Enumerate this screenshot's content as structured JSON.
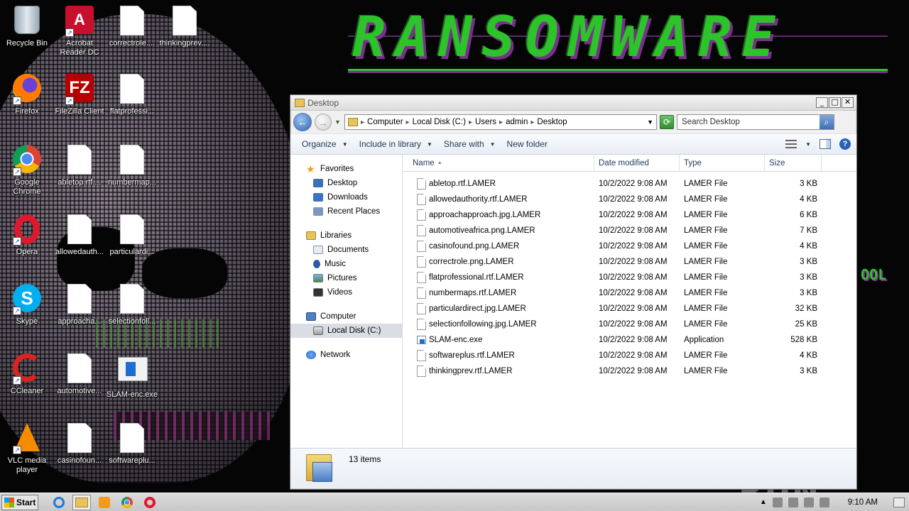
{
  "desktop": {
    "wallpaper_title": "RANSOMWARE",
    "wallpaper_side_text": "OOL",
    "icons": [
      {
        "label": "Recycle Bin"
      },
      {
        "label": "Acrobat Reader DC"
      },
      {
        "label": "correctrole...."
      },
      {
        "label": "thinkingprev...."
      },
      {
        "label": "Firefox"
      },
      {
        "label": "FileZilla Client"
      },
      {
        "label": "flatprofessi..."
      },
      {
        "label": "Google Chrome"
      },
      {
        "label": "abletop.rtf...."
      },
      {
        "label": "numbermap..."
      },
      {
        "label": "Opera"
      },
      {
        "label": "allowedauth..."
      },
      {
        "label": "particulardi..."
      },
      {
        "label": "Skype"
      },
      {
        "label": "approacha..."
      },
      {
        "label": "selectionfoll..."
      },
      {
        "label": "CCleaner"
      },
      {
        "label": "automotive..."
      },
      {
        "label": "SLAM-enc.exe"
      },
      {
        "label": "VLC media player"
      },
      {
        "label": "casinofoun..."
      },
      {
        "label": "softwareplu..."
      }
    ]
  },
  "window": {
    "title": "Desktop",
    "buttons": {
      "minimize": "_",
      "maximize": "□",
      "close": "✕"
    },
    "address": {
      "crumbs": [
        "Computer",
        "Local Disk (C:)",
        "Users",
        "admin",
        "Desktop"
      ]
    },
    "search_placeholder": "Search Desktop",
    "toolbar": {
      "organize": "Organize",
      "include_in_library": "Include in library",
      "share_with": "Share with",
      "new_folder": "New folder"
    },
    "nav": {
      "favorites": "Favorites",
      "favorites_items": [
        "Desktop",
        "Downloads",
        "Recent Places"
      ],
      "libraries": "Libraries",
      "libraries_items": [
        "Documents",
        "Music",
        "Pictures",
        "Videos"
      ],
      "computer": "Computer",
      "computer_items": [
        "Local Disk (C:)"
      ],
      "network": "Network"
    },
    "columns": {
      "name": "Name",
      "date": "Date modified",
      "type": "Type",
      "size": "Size"
    },
    "files": [
      {
        "name": "abletop.rtf.LAMER",
        "date": "10/2/2022 9:08 AM",
        "type": "LAMER File",
        "size": "3 KB"
      },
      {
        "name": "allowedauthority.rtf.LAMER",
        "date": "10/2/2022 9:08 AM",
        "type": "LAMER File",
        "size": "4 KB"
      },
      {
        "name": "approachapproach.jpg.LAMER",
        "date": "10/2/2022 9:08 AM",
        "type": "LAMER File",
        "size": "6 KB"
      },
      {
        "name": "automotiveafrica.png.LAMER",
        "date": "10/2/2022 9:08 AM",
        "type": "LAMER File",
        "size": "7 KB"
      },
      {
        "name": "casinofound.png.LAMER",
        "date": "10/2/2022 9:08 AM",
        "type": "LAMER File",
        "size": "4 KB"
      },
      {
        "name": "correctrole.png.LAMER",
        "date": "10/2/2022 9:08 AM",
        "type": "LAMER File",
        "size": "3 KB"
      },
      {
        "name": "flatprofessional.rtf.LAMER",
        "date": "10/2/2022 9:08 AM",
        "type": "LAMER File",
        "size": "3 KB"
      },
      {
        "name": "numbermaps.rtf.LAMER",
        "date": "10/2/2022 9:08 AM",
        "type": "LAMER File",
        "size": "3 KB"
      },
      {
        "name": "particulardirect.jpg.LAMER",
        "date": "10/2/2022 9:08 AM",
        "type": "LAMER File",
        "size": "32 KB"
      },
      {
        "name": "selectionfollowing.jpg.LAMER",
        "date": "10/2/2022 9:08 AM",
        "type": "LAMER File",
        "size": "25 KB"
      },
      {
        "name": "SLAM-enc.exe",
        "date": "10/2/2022 9:08 AM",
        "type": "Application",
        "size": "528 KB"
      },
      {
        "name": "softwareplus.rtf.LAMER",
        "date": "10/2/2022 9:08 AM",
        "type": "LAMER File",
        "size": "4 KB"
      },
      {
        "name": "thinkingprev.rtf.LAMER",
        "date": "10/2/2022 9:08 AM",
        "type": "LAMER File",
        "size": "3 KB"
      }
    ],
    "status": "13 items"
  },
  "watermark": "ANY RUN",
  "taskbar": {
    "start": "Start",
    "clock": "9:10 AM"
  }
}
